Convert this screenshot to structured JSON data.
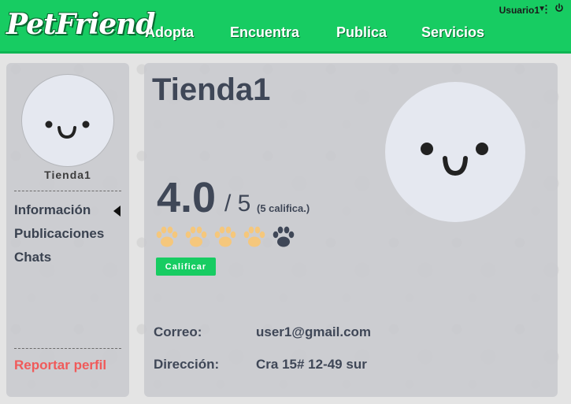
{
  "header": {
    "logo": "PetFriend",
    "nav": [
      "Adopta",
      "Encuentra",
      "Publica",
      "Servicios"
    ],
    "user": "Usuario1",
    "icons": {
      "caret": "caret-down-icon",
      "menu": "kebab-menu-icon",
      "power": "power-icon"
    }
  },
  "sidebar": {
    "store_name": "Tienda1",
    "links": [
      "Información",
      "Publicaciones",
      "Chats"
    ],
    "active_link": "Información",
    "report": "Reportar perfil"
  },
  "profile": {
    "title": "Tienda1",
    "rating": "4.0",
    "rating_max": "/ 5",
    "rating_count": "(5 califica.)",
    "paws_filled": 4,
    "paws_total": 5,
    "rate_button": "Calificar",
    "email_label": "Correo:",
    "email": "user1@gmail.com",
    "address_label": "Dirección:",
    "address": "Cra 15# 12-49 sur"
  },
  "colors": {
    "brand": "#17cc62",
    "paw_filled": "#f5c77c",
    "paw_empty": "#3f4757",
    "report": "#f05a5a",
    "text": "#3f4757"
  }
}
